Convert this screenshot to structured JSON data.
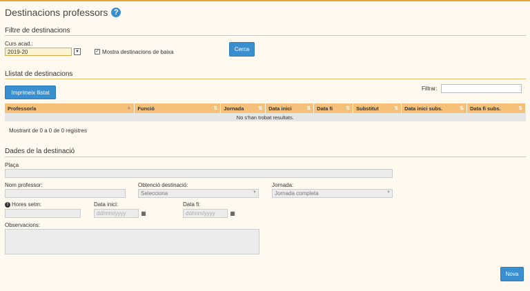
{
  "page": {
    "title": "Destinacions professors"
  },
  "filter": {
    "section_title": "Filtre de destinacions",
    "course_label": "Curs acad.:",
    "course_value": "2019-20",
    "show_inactive_label": "Mostra destinacions de baixa",
    "search_button": "Cerca"
  },
  "list": {
    "section_title": "Llistat de destinacions",
    "print_button": "Imprimeix llistat",
    "filter_label": "Filtrar:",
    "columns": [
      "Professor/a",
      "Funció",
      "Jornada",
      "Data inici",
      "Data fi",
      "Substitut",
      "Data inici subs.",
      "Data fi subs."
    ],
    "empty_message": "No s'han trobat resultats.",
    "info": "Mostrant de 0 a 0 de 0 registres"
  },
  "details": {
    "section_title": "Dades de la destinació",
    "place_label": "Plaça",
    "teacher_label": "Nom professor:",
    "origin_label": "Obtenció destinació:",
    "origin_value": "Selecciona",
    "schedule_label": "Jornada:",
    "schedule_value": "Jornada completa",
    "hours_label": "Hores setm:",
    "start_label": "Data inici:",
    "start_placeholder": "dd/mm/yyyy",
    "end_label": "Data fi:",
    "end_placeholder": "dd/mm/yyyy",
    "notes_label": "Observacions:",
    "new_button": "Nova"
  },
  "colors": {
    "accent": "#e8a53a",
    "header": "#f4c07a",
    "button": "#3a8fd0",
    "background": "#fff9ef"
  }
}
